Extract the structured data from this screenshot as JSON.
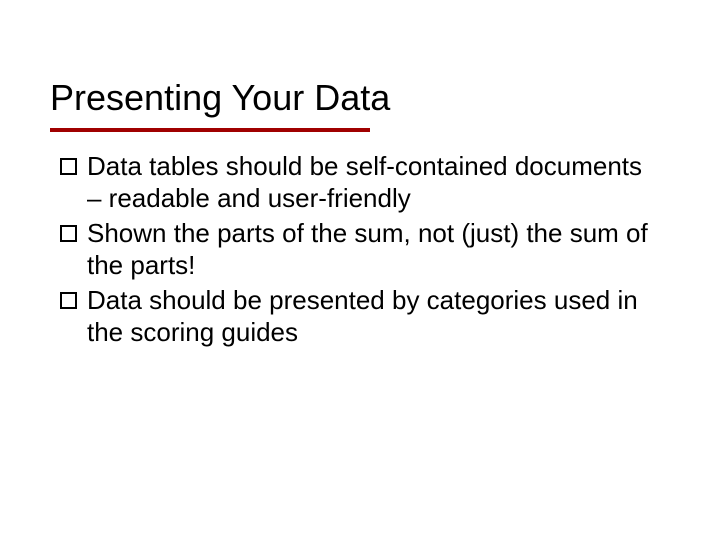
{
  "slide": {
    "title": "Presenting Your Data",
    "bullets": [
      "Data tables should be self-contained documents – readable and user-friendly",
      "Shown the parts of the sum, not (just) the sum of the parts!",
      "Data should be presented by categories used in the scoring guides"
    ]
  }
}
